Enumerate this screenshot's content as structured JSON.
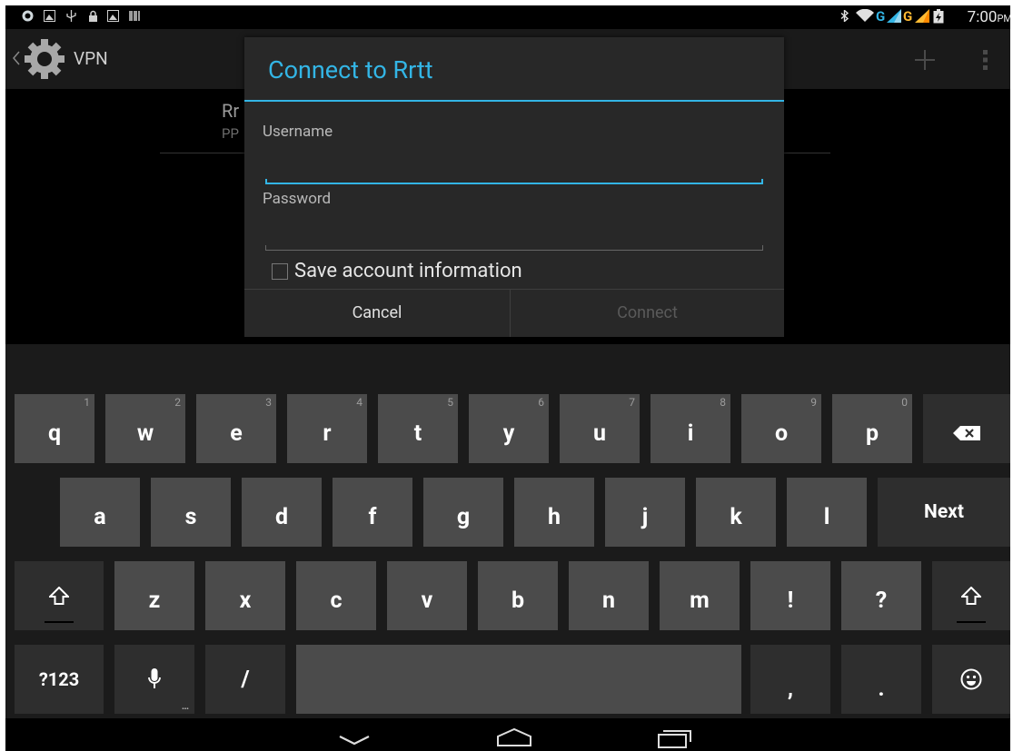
{
  "status_bar": {
    "time": "7:00",
    "ampm": "PM",
    "network_1": "G",
    "network_2": "G"
  },
  "action_bar": {
    "title": "VPN"
  },
  "vpn_list": {
    "name": "Rr",
    "type": "PP"
  },
  "dialog": {
    "title": "Connect to Rrtt",
    "username_label": "Username",
    "username_value": "",
    "password_label": "Password",
    "password_value": "",
    "save_label": "Save account information",
    "save_checked": false,
    "cancel_label": "Cancel",
    "connect_label": "Connect"
  },
  "keyboard": {
    "row1": [
      {
        "l": "q",
        "h": "1"
      },
      {
        "l": "w",
        "h": "2"
      },
      {
        "l": "e",
        "h": "3"
      },
      {
        "l": "r",
        "h": "4"
      },
      {
        "l": "t",
        "h": "5"
      },
      {
        "l": "y",
        "h": "6"
      },
      {
        "l": "u",
        "h": "7"
      },
      {
        "l": "i",
        "h": "8"
      },
      {
        "l": "o",
        "h": "9"
      },
      {
        "l": "p",
        "h": "0"
      }
    ],
    "row2": [
      "a",
      "s",
      "d",
      "f",
      "g",
      "h",
      "j",
      "k",
      "l"
    ],
    "row3": [
      "z",
      "x",
      "c",
      "v",
      "b",
      "n",
      "m",
      "!",
      "?"
    ],
    "next_label": "Next",
    "symbols_label": "?123",
    "slash_label": "/",
    "comma_label": ",",
    "period_label": "."
  },
  "colors": {
    "accent": "#33b5e5",
    "key": "#4b4b4b",
    "key_dark": "#2e2e2e",
    "keyboard_bg": "#1b1b1b"
  },
  "icons": [
    "bluetooth-icon",
    "wifi-icon",
    "signal-icon",
    "battery-icon",
    "settings-gear-icon",
    "add-icon",
    "overflow-menu-icon",
    "backspace-icon",
    "shift-icon",
    "mic-icon",
    "emoji-icon",
    "back-icon",
    "home-icon",
    "recents-icon"
  ]
}
